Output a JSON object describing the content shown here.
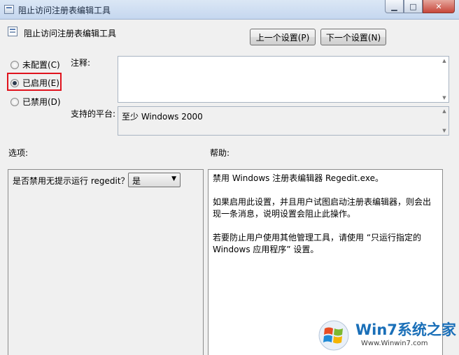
{
  "window": {
    "title": "阻止访问注册表编辑工具",
    "min_glyph": "▁",
    "max_glyph": "□",
    "close_glyph": "✕"
  },
  "header": {
    "title": "阻止访问注册表编辑工具",
    "prev_label": "上一个设置(P)",
    "next_label": "下一个设置(N)"
  },
  "state": {
    "options": [
      {
        "label": "未配置(C)",
        "selected": false
      },
      {
        "label": "已启用(E)",
        "selected": true
      },
      {
        "label": "已禁用(D)",
        "selected": false
      }
    ]
  },
  "comment": {
    "label": "注释:",
    "value": ""
  },
  "platform": {
    "label": "支持的平台:",
    "value": "至少 Windows 2000"
  },
  "options_panel": {
    "label": "选项:",
    "question": "是否禁用无提示运行 regedit？",
    "select_value": "是"
  },
  "help_panel": {
    "label": "帮助:",
    "paragraphs": [
      "禁用 Windows 注册表编辑器 Regedit.exe。",
      "如果启用此设置，并且用户试图启动注册表编辑器，则会出现一条消息，说明设置会阻止此操作。",
      "若要防止用户使用其他管理工具，请使用 “只运行指定的 Windows 应用程序” 设置。"
    ]
  },
  "watermark": {
    "brand": "Win7系统之家",
    "url": "Www.Winwin7.com"
  },
  "colors": {
    "highlight": "#e0131d",
    "titlebar": "#c5d7ef",
    "close": "#c7463a"
  }
}
